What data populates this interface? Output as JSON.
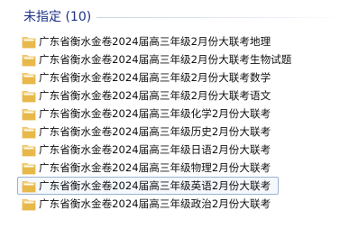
{
  "group": {
    "title": "未指定 (10)"
  },
  "icons": {
    "item_icon": "folder-icon",
    "folder_colors": {
      "body": "#f4d27a",
      "front": "#e8b84a",
      "paper": "#fdfaf2"
    }
  },
  "items": [
    {
      "label": "广东省衡水金卷2024届高三年级2月份大联考地理",
      "selected": false
    },
    {
      "label": "广东省衡水金卷2024届高三年级2月份大联考生物试题",
      "selected": false
    },
    {
      "label": "广东省衡水金卷2024届高三年级2月份大联考数学",
      "selected": false
    },
    {
      "label": "广东省衡水金卷2024届高三年级2月份大联考语文",
      "selected": false
    },
    {
      "label": "广东省衡水金卷2024届高三年级化学2月份大联考",
      "selected": false
    },
    {
      "label": "广东省衡水金卷2024届高三年级历史2月份大联考",
      "selected": false
    },
    {
      "label": "广东省衡水金卷2024届高三年级日语2月份大联考",
      "selected": false
    },
    {
      "label": "广东省衡水金卷2024届高三年级物理2月份大联考",
      "selected": false
    },
    {
      "label": "广东省衡水金卷2024届高三年级英语2月份大联考",
      "selected": true
    },
    {
      "label": "广东省衡水金卷2024届高三年级政治2月份大联考",
      "selected": false
    }
  ]
}
